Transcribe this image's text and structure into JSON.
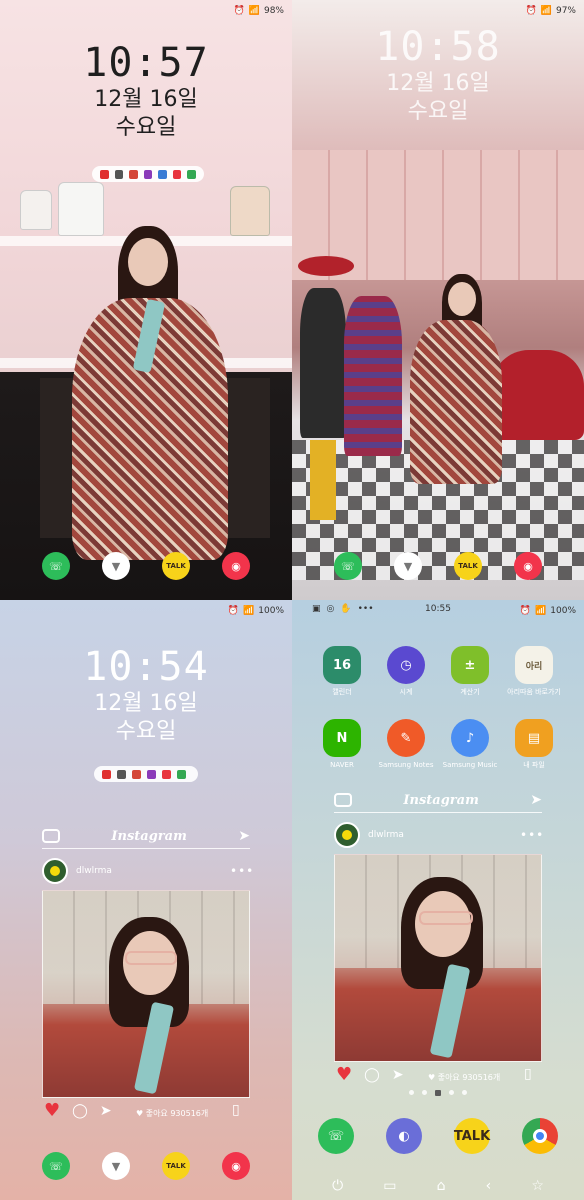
{
  "panel1": {
    "status": {
      "alarm": "⏰",
      "wifi": "📶",
      "battery": "98%"
    },
    "time": "10:57",
    "date": "12월 16일",
    "day": "수요일"
  },
  "panel2": {
    "status": {
      "alarm": "⏰",
      "wifi": "📶",
      "battery": "97%"
    },
    "time": "10:58",
    "date": "12월 16일",
    "day": "수요일"
  },
  "panel3": {
    "status": {
      "alarm": "⏰",
      "wifi": "📶",
      "battery": "100%"
    },
    "time": "10:54",
    "date": "12월 16일",
    "day": "수요일",
    "instagram_title": "Instagram",
    "username": "dlwlrma",
    "likes": "♥ 좋아요 930516개"
  },
  "panel4": {
    "status": {
      "time": "10:55",
      "battery": "100%"
    },
    "apps": [
      {
        "label": "캘린더",
        "glyph": "16",
        "color": "#2c8c6a"
      },
      {
        "label": "시계",
        "glyph": "◷",
        "color": "#5a49d0"
      },
      {
        "label": "계산기",
        "glyph": "±",
        "color": "#7fbf2a"
      },
      {
        "label": "아리따움 바로가기",
        "glyph": "아리",
        "color": "#f4f2e8"
      },
      {
        "label": "NAVER",
        "glyph": "N",
        "color": "#2db400"
      },
      {
        "label": "Samsung Notes",
        "glyph": "✎",
        "color": "#f05a28"
      },
      {
        "label": "Samsung Music",
        "glyph": "♪",
        "color": "#4b8ef2"
      },
      {
        "label": "내 파일",
        "glyph": "▤",
        "color": "#f0a020"
      }
    ],
    "instagram_title": "Instagram",
    "username": "dlwlrma",
    "likes": "♥ 좋아요 930516개"
  },
  "dock": {
    "phone_icon": "phone-icon",
    "torch_icon": "flashlight-icon",
    "talk_label": "TALK",
    "camera_icon": "camera-icon"
  },
  "colors": {
    "phone": "#2dbd5a",
    "kakao": "#f7d31a",
    "camera": "#f2344b",
    "heart": "#e8343e"
  }
}
